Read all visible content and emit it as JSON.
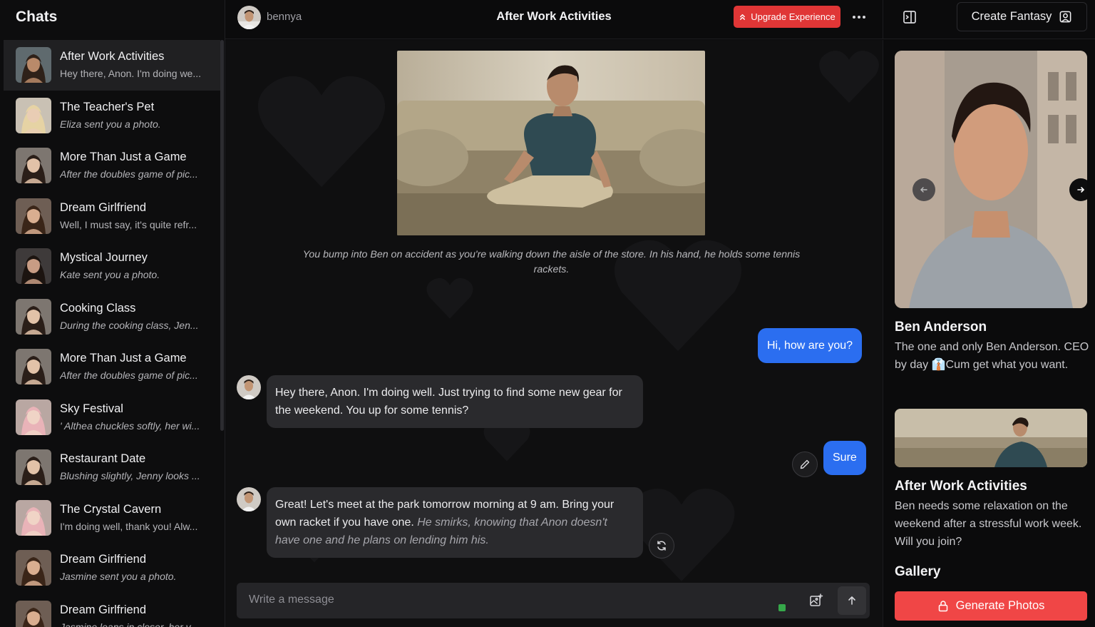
{
  "sidebar": {
    "title": "Chats",
    "chats": [
      {
        "name": "After Work Activities",
        "preview": "Hey there, Anon. I'm doing we...",
        "italic": false,
        "active": true,
        "skin": "#b98a6a",
        "hair": "#2e2119",
        "bg": "#5f6a6e"
      },
      {
        "name": "The Teacher's Pet",
        "preview": "Eliza sent you a photo.",
        "italic": true,
        "active": false,
        "skin": "#e9cdb4",
        "hair": "#e6d3a4",
        "bg": "#c9c1b4"
      },
      {
        "name": "More Than Just a Game",
        "preview": "After the doubles game of pic...",
        "italic": true,
        "active": false,
        "skin": "#e2c2a8",
        "hair": "#2a1e18",
        "bg": "#7d7670"
      },
      {
        "name": "Dream Girlfriend",
        "preview": "Well, I must say, it's quite refr...",
        "italic": false,
        "active": false,
        "skin": "#d9ae90",
        "hair": "#3a2518",
        "bg": "#6e5e54"
      },
      {
        "name": "Mystical Journey",
        "preview": "Kate sent you a photo.",
        "italic": true,
        "active": false,
        "skin": "#c89c84",
        "hair": "#1c1410",
        "bg": "#3e3a3a"
      },
      {
        "name": "Cooking Class",
        "preview": "During the cooking class, Jen...",
        "italic": true,
        "active": false,
        "skin": "#e2c2a8",
        "hair": "#2a1e18",
        "bg": "#7d7670"
      },
      {
        "name": "More Than Just a Game",
        "preview": "After the doubles game of pic...",
        "italic": true,
        "active": false,
        "skin": "#e2c2a8",
        "hair": "#2a1e18",
        "bg": "#7d7670"
      },
      {
        "name": "Sky Festival",
        "preview": "' Althea chuckles softly, her wi...",
        "italic": true,
        "active": false,
        "skin": "#f0d4c6",
        "hair": "#e9b3b8",
        "bg": "#b9a7a2"
      },
      {
        "name": "Restaurant Date",
        "preview": "Blushing slightly, Jenny looks ...",
        "italic": true,
        "active": false,
        "skin": "#e2c2a8",
        "hair": "#2a1e18",
        "bg": "#7d7670"
      },
      {
        "name": "The Crystal Cavern",
        "preview": "I'm doing well, thank you! Alw...",
        "italic": false,
        "active": false,
        "skin": "#f0d4c6",
        "hair": "#e9b3b8",
        "bg": "#b9a7a2"
      },
      {
        "name": "Dream Girlfriend",
        "preview": "Jasmine sent you a photo.",
        "italic": true,
        "active": false,
        "skin": "#d9ae90",
        "hair": "#3a2518",
        "bg": "#6e5e54"
      },
      {
        "name": "Dream Girlfriend",
        "preview": "Jasmine leans in closer, her v...",
        "italic": true,
        "active": false,
        "skin": "#d9ae90",
        "hair": "#3a2518",
        "bg": "#6e5e54"
      }
    ]
  },
  "header": {
    "username": "bennya",
    "title": "After Work Activities",
    "upgrade_label": "Upgrade Experience",
    "create_label": "Create Fantasy"
  },
  "chat": {
    "narration": "You bump into Ben on accident as you're walking down the aisle of the store. In his hand, he holds some tennis rackets.",
    "messages": {
      "user1": "Hi, how are you?",
      "bot1": "Hey there, Anon. I'm doing well. Just trying to find some new gear for the weekend. You up for some tennis?",
      "user2": "Sure",
      "bot2_text": "Great! Let's meet at the park tomorrow morning at 9 am. Bring your own racket if you have one.",
      "bot2_action": "He smirks, knowing that Anon doesn't have one and he plans on lending him his."
    },
    "composer_placeholder": "Write a message"
  },
  "profile": {
    "name": "Ben Anderson",
    "bio": "The one and only Ben Anderson. CEO by day 👔Cum get what you want.",
    "scenario_title": "After Work Activities",
    "scenario_desc": "Ben needs some relaxation on the weekend after a stressful work week. Will you join?",
    "gallery_title": "Gallery",
    "generate_label": "Generate Photos"
  },
  "colors": {
    "accent_blue": "#2b6ef0",
    "upgrade_red": "#e03636",
    "generate_red": "#f04646",
    "status_green": "#36a84a"
  }
}
